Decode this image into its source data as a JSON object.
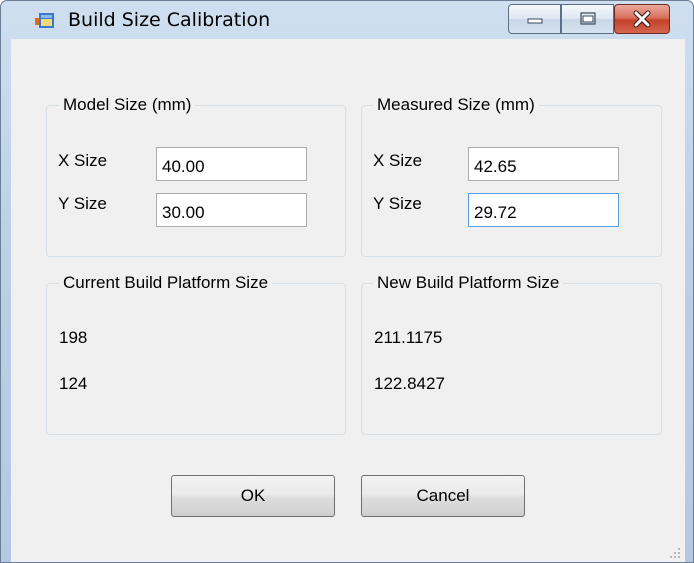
{
  "window": {
    "title": "Build Size Calibration"
  },
  "icons": {
    "app": "app-icon",
    "minimize": "minimize-icon",
    "maximize": "maximize-icon",
    "close": "close-icon",
    "grip": "resize-grip-icon"
  },
  "colors": {
    "close_button": "#c7432c",
    "frame": "#bcd1e8",
    "client": "#f0f0f0",
    "focus_border": "#569de5"
  },
  "model_size": {
    "title": "Model Size (mm)",
    "x_label": "X Size",
    "x_value": "40.00",
    "y_label": "Y Size",
    "y_value": "30.00"
  },
  "measured_size": {
    "title": "Measured Size (mm)",
    "x_label": "X Size",
    "x_value": "42.65",
    "y_label": "Y Size",
    "y_value": "29.72"
  },
  "current_platform": {
    "title": "Current Build Platform Size",
    "x_value": "198",
    "y_value": "124"
  },
  "new_platform": {
    "title": "New Build Platform Size",
    "x_value": "211.1175",
    "y_value": "122.8427"
  },
  "buttons": {
    "ok": "OK",
    "cancel": "Cancel"
  }
}
